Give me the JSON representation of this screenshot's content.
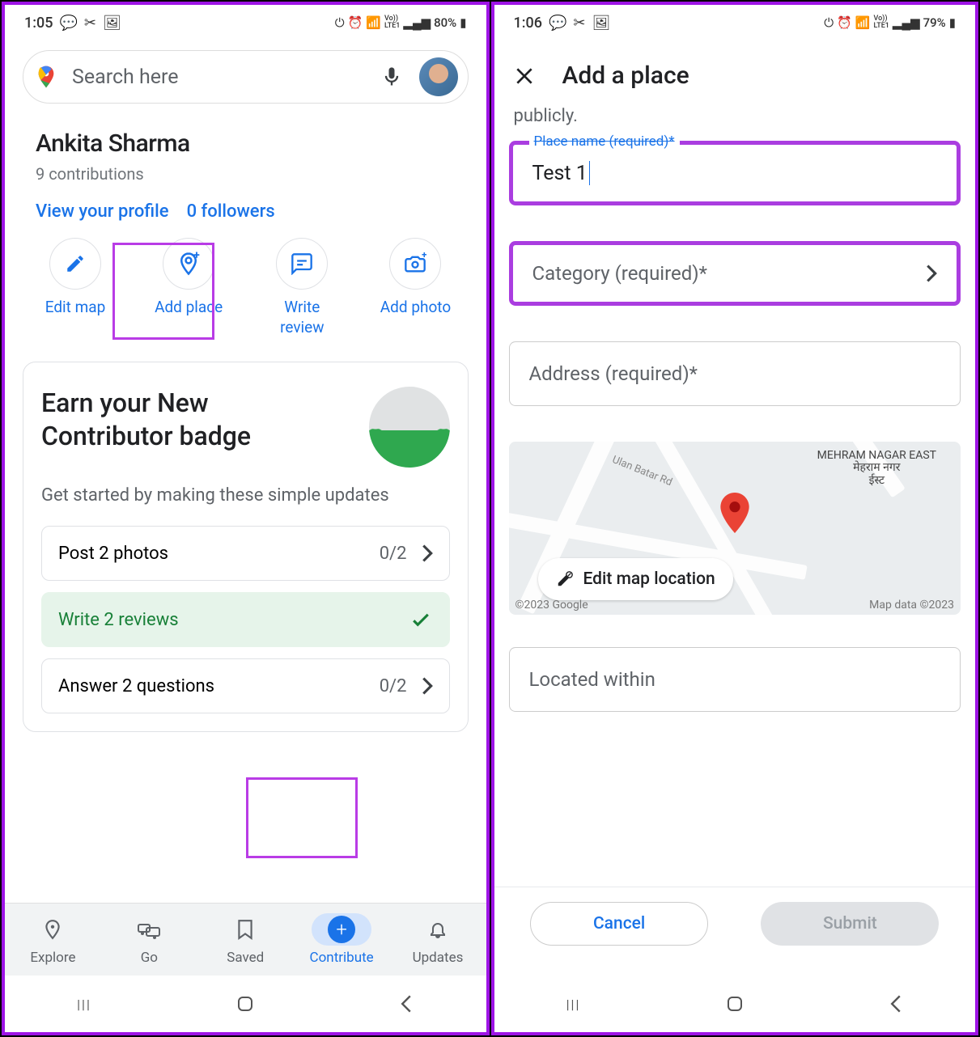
{
  "phone1": {
    "status": {
      "time": "1:05",
      "battery": "80%"
    },
    "search": {
      "placeholder": "Search here"
    },
    "profile": {
      "name": "Ankita Sharma",
      "contributions": "9 contributions",
      "view_profile": "View your profile",
      "followers": "0 followers"
    },
    "actions": {
      "edit_map": "Edit map",
      "add_place": "Add place",
      "write_review": "Write\nreview",
      "add_photo": "Add photo"
    },
    "badge": {
      "title": "Earn your New Contributor badge",
      "subtitle": "Get started by making these simple updates",
      "tasks": {
        "photos": {
          "label": "Post 2 photos",
          "progress": "0/2"
        },
        "reviews": {
          "label": "Write 2 reviews"
        },
        "questions": {
          "label": "Answer 2 questions",
          "progress": "0/2"
        }
      }
    },
    "nav": {
      "explore": "Explore",
      "go": "Go",
      "saved": "Saved",
      "contribute": "Contribute",
      "updates": "Updates"
    }
  },
  "phone2": {
    "status": {
      "time": "1:06",
      "battery": "79%"
    },
    "header": {
      "title": "Add a place"
    },
    "publicly_tail": "publicly.",
    "form": {
      "place_name_label": "Place name (required)*",
      "place_name_value": "Test 1",
      "category_placeholder": "Category (required)*",
      "address_placeholder": "Address (required)*",
      "located_within_placeholder": "Located within"
    },
    "map": {
      "edit_label": "Edit map location",
      "credit_left": "©2023 Google",
      "credit_right": "Map data ©2023",
      "area_label": "MEHRAM NAGAR EAST\nमेहराम नगर\nईस्ट",
      "road_label": "Ulan Batar Rd"
    },
    "buttons": {
      "cancel": "Cancel",
      "submit": "Submit"
    }
  }
}
